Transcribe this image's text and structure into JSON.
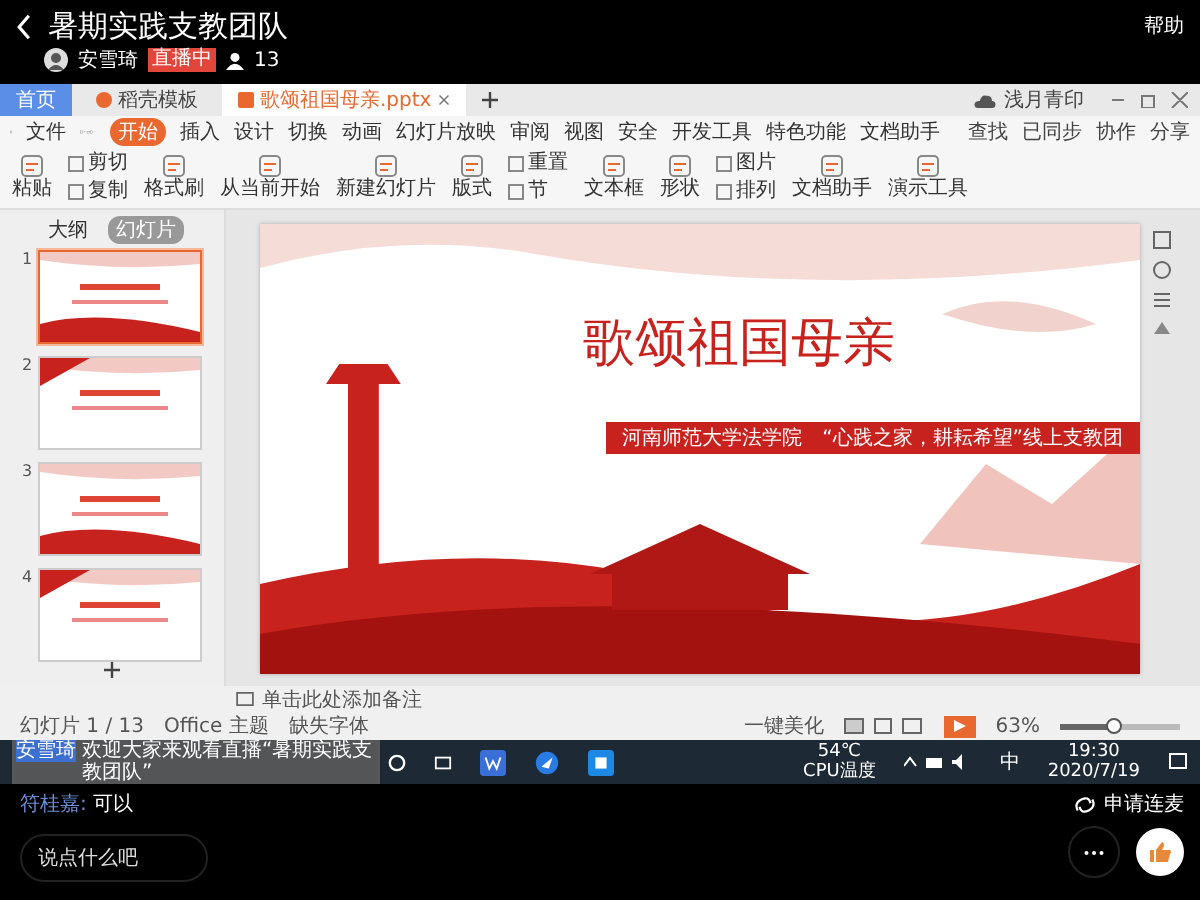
{
  "live": {
    "title": "暑期实践支教团队",
    "host": "安雪琦",
    "badge": "直播中",
    "viewers": "13",
    "help": "帮助"
  },
  "wps": {
    "tabs": [
      {
        "label": "首页",
        "kind": "home",
        "selected": false
      },
      {
        "label": "稻壳模板",
        "kind": "template",
        "selected": false
      },
      {
        "label": "歌颂祖国母亲.pptx",
        "kind": "doc",
        "selected": true
      }
    ],
    "account": "浅月青印",
    "file_menu": "文件",
    "menu": [
      {
        "label": "开始",
        "selected": true
      },
      {
        "label": "插入",
        "selected": false
      },
      {
        "label": "设计",
        "selected": false
      },
      {
        "label": "切换",
        "selected": false
      },
      {
        "label": "动画",
        "selected": false
      },
      {
        "label": "幻灯片放映",
        "selected": false
      },
      {
        "label": "审阅",
        "selected": false
      },
      {
        "label": "视图",
        "selected": false
      },
      {
        "label": "安全",
        "selected": false
      },
      {
        "label": "开发工具",
        "selected": false
      },
      {
        "label": "特色功能",
        "selected": false
      },
      {
        "label": "文档助手",
        "selected": false
      }
    ],
    "menu_right": [
      "查找",
      "已同步",
      "协作",
      "分享"
    ],
    "ribbon": [
      [
        {
          "label": "粘贴",
          "kind": "large"
        }
      ],
      [
        {
          "label": "剪切",
          "kind": "small"
        },
        {
          "label": "复制",
          "kind": "small"
        }
      ],
      [
        {
          "label": "格式刷",
          "kind": "large"
        }
      ],
      [
        {
          "label": "从当前开始",
          "kind": "large"
        }
      ],
      [
        {
          "label": "新建幻灯片",
          "kind": "large"
        }
      ],
      [
        {
          "label": "版式",
          "kind": "large"
        }
      ],
      [
        {
          "label": "重置",
          "kind": "small"
        },
        {
          "label": "节",
          "kind": "small"
        }
      ],
      [
        {
          "label": "文本框",
          "kind": "large"
        }
      ],
      [
        {
          "label": "形状",
          "kind": "large"
        }
      ],
      [
        {
          "label": "图片",
          "kind": "small"
        },
        {
          "label": "排列",
          "kind": "small"
        }
      ],
      [
        {
          "label": "文档助手",
          "kind": "large"
        }
      ],
      [
        {
          "label": "演示工具",
          "kind": "large"
        }
      ]
    ],
    "panel_tabs": [
      {
        "label": "大纲",
        "selected": false
      },
      {
        "label": "幻灯片",
        "selected": true
      }
    ],
    "thumbnails": [
      {
        "number": "1",
        "selected": true
      },
      {
        "number": "2",
        "selected": false
      },
      {
        "number": "3",
        "selected": false
      },
      {
        "number": "4",
        "selected": false
      }
    ],
    "slide": {
      "title": "歌颂祖国母亲",
      "subtitle": "河南师范大学法学院　“心践之家，耕耘希望”线上支教团"
    },
    "notes_placeholder": "单击此处添加备注",
    "status": {
      "slide_count": "幻灯片 1 / 13",
      "theme": "Office 主题",
      "missing_font": "缺失字体",
      "beautify": "一键美化",
      "zoom": "63%",
      "level": 0.45
    }
  },
  "taskbar": {
    "temp": "54℃",
    "temp_label": "CPU温度",
    "ime": "中",
    "time": "19:30",
    "date": "2020/7/19"
  },
  "overlay_comment": {
    "user": "安雪琦",
    "text": "欢迎大家来观看直播“暑期实践支教团队”"
  },
  "chat": [
    {
      "user": "符桂嘉:",
      "text": "可以"
    }
  ],
  "input": {
    "placeholder": "说点什么吧"
  },
  "connect": "申请连麦"
}
